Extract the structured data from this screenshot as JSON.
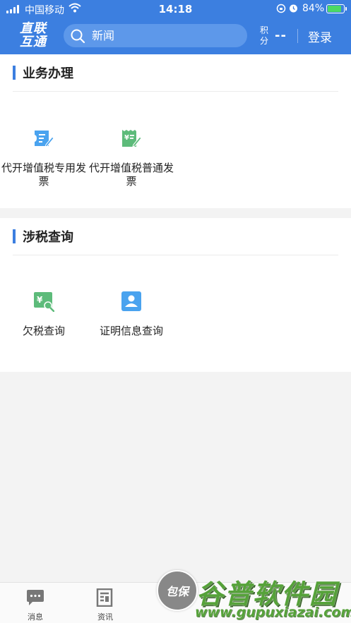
{
  "status_bar": {
    "carrier": "中国移动",
    "time": "14:18",
    "battery": "84%"
  },
  "header": {
    "logo_line1": "直联",
    "logo_line2": "互通",
    "search_placeholder": "新闻",
    "points_label": "积分",
    "points_value": "--",
    "login_label": "登录"
  },
  "sections": [
    {
      "title": "业务办理",
      "items": [
        {
          "label": "代开增值税专用发票",
          "icon": "invoice-special-icon"
        },
        {
          "label": "代开增值税普通发票",
          "icon": "invoice-general-icon"
        }
      ]
    },
    {
      "title": "涉税查询",
      "items": [
        {
          "label": "欠税查询",
          "icon": "tax-search-icon"
        },
        {
          "label": "证明信息查询",
          "icon": "certificate-icon"
        }
      ]
    }
  ],
  "bottom_nav": {
    "items": [
      {
        "label": "消息",
        "icon": "message-icon"
      },
      {
        "label": "资讯",
        "icon": "news-icon"
      }
    ],
    "center_label": "包保"
  },
  "watermark": {
    "main": "谷普软件园",
    "url": "www.gupuxiazai.com"
  },
  "colors": {
    "brand_blue": "#3c7fe0",
    "icon_blue": "#4aa3ef",
    "icon_green": "#5dbb7a"
  }
}
